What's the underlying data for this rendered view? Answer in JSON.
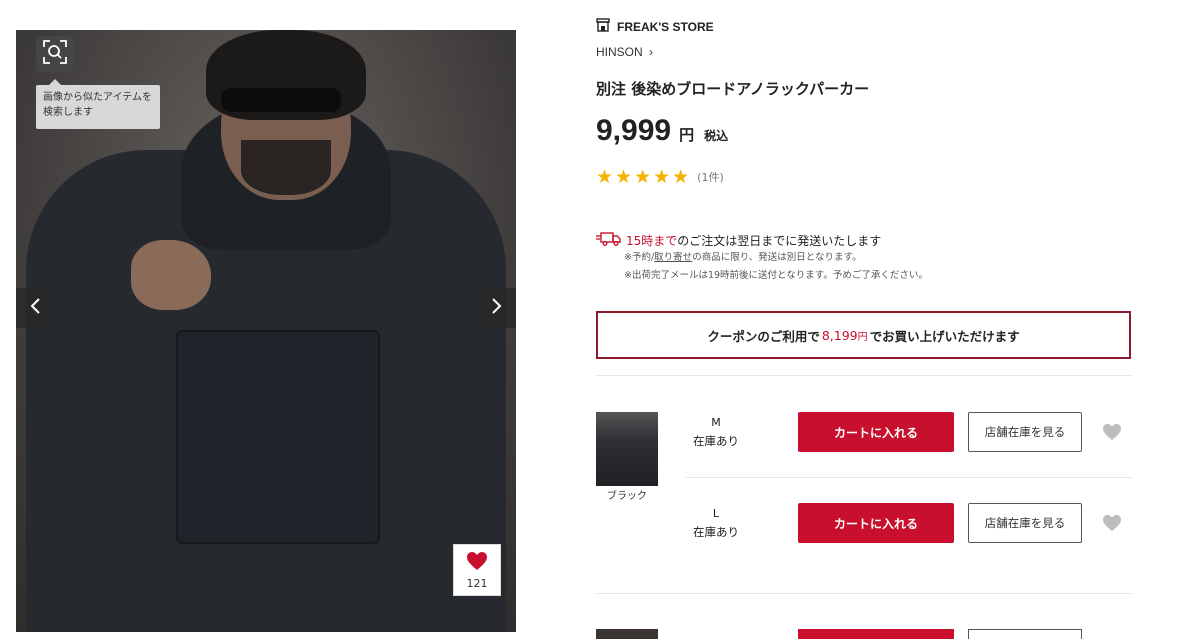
{
  "gallery": {
    "search_tooltip": "画像から似たアイテムを検索します",
    "favorite_count": "121"
  },
  "product": {
    "shop_name": "FREAK'S STORE",
    "brand": "HINSON",
    "title": "別注 後染めブロードアノラックパーカー",
    "price": "9,999",
    "currency": "円",
    "tax_label": "税込",
    "stars": "★★★★★",
    "review_count": "(1件)"
  },
  "shipping": {
    "deadline": "15時まで",
    "main_text": "のご注文は翌日までに発送いたします",
    "note1_prefix": "※予約/",
    "note1_link": "取り寄せ",
    "note1_suffix": "の商品に限り、発送は別日となります。",
    "note2": "※出荷完了メールは19時前後に送付となります。予めご了承ください。"
  },
  "coupon": {
    "prefix": "クーポンのご利用で",
    "price": "8,199",
    "currency": "円",
    "suffix": "でお買い上げいただけます"
  },
  "variants": {
    "color_label": "ブラック",
    "rows": [
      {
        "size": "M",
        "stock": "在庫あり",
        "cart_label": "カートに入れる",
        "store_label": "店舗在庫を見る"
      },
      {
        "size": "L",
        "stock": "在庫あり",
        "cart_label": "カートに入れる",
        "store_label": "店舗在庫を見る"
      }
    ]
  },
  "colors": {
    "accent_red": "#c8102e",
    "coupon_border": "#8b1a2b",
    "star": "#f5b400"
  }
}
